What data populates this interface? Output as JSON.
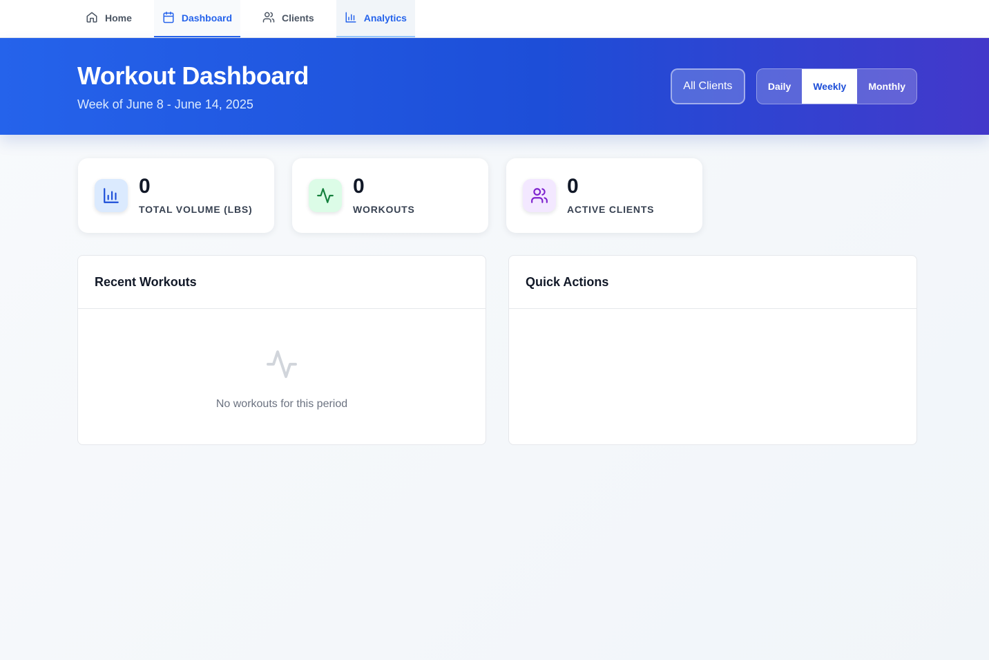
{
  "nav": {
    "items": [
      {
        "label": "Home",
        "icon": "home-icon"
      },
      {
        "label": "Dashboard",
        "icon": "calendar-icon"
      },
      {
        "label": "Clients",
        "icon": "users-icon"
      },
      {
        "label": "Analytics",
        "icon": "bar-chart-icon"
      }
    ],
    "active": "Dashboard"
  },
  "header": {
    "title": "Workout Dashboard",
    "subtitle": "Week of June 8 - June 14, 2025",
    "client_select": "All Clients",
    "periods": [
      "Daily",
      "Weekly",
      "Monthly"
    ],
    "active_period": "Weekly"
  },
  "stats": [
    {
      "value": "0",
      "label": "TOTAL VOLUME (LBS)",
      "icon": "bar-chart-icon",
      "color": "#1d4ed8"
    },
    {
      "value": "0",
      "label": "WORKOUTS",
      "icon": "activity-icon",
      "color": "#15803d"
    },
    {
      "value": "0",
      "label": "ACTIVE CLIENTS",
      "icon": "users-icon",
      "color": "#7e22ce"
    }
  ],
  "panels": {
    "recent": {
      "title": "Recent Workouts",
      "empty_text": "No workouts for this period"
    },
    "quick": {
      "title": "Quick Actions"
    }
  },
  "colors": {
    "accent": "#2563eb",
    "banner_start": "#2563eb",
    "banner_end": "#4338ca"
  }
}
